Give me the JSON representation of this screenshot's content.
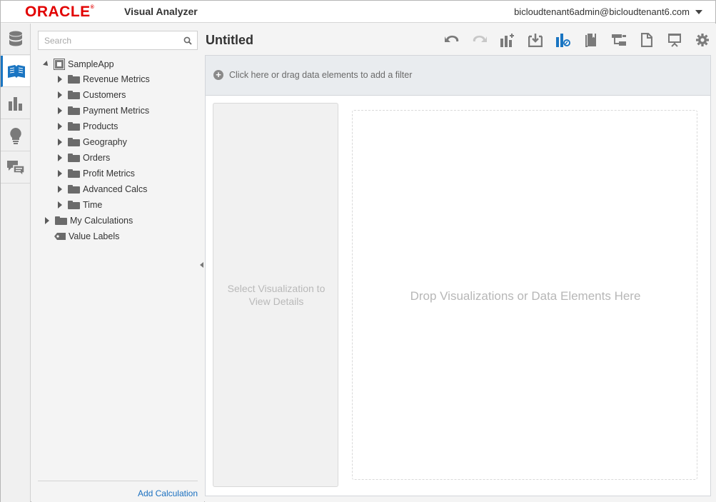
{
  "header": {
    "brand": "ORACLE",
    "brand_mark": "®",
    "app_title": "Visual Analyzer",
    "user": "bicloudtenant6admin@bicloudtenant6.com"
  },
  "rail": {
    "items": [
      {
        "icon": "database-icon",
        "active": false
      },
      {
        "icon": "open-book-icon",
        "active": true
      },
      {
        "icon": "bar-chart-icon",
        "active": false
      },
      {
        "icon": "lightbulb-icon",
        "active": false
      },
      {
        "icon": "chat-bubbles-icon",
        "active": false
      }
    ]
  },
  "data_panel": {
    "search_placeholder": "Search",
    "root": "SampleApp",
    "children": [
      "Revenue Metrics",
      "Customers",
      "Payment Metrics",
      "Products",
      "Geography",
      "Orders",
      "Profit Metrics",
      "Advanced Calcs",
      "Time"
    ],
    "my_calculations": "My Calculations",
    "value_labels": "Value Labels",
    "add_calculation": "Add Calculation"
  },
  "main": {
    "title": "Untitled",
    "toolbar": [
      "undo-icon",
      "redo-icon",
      "add-visualization-icon",
      "add-data-icon",
      "explore-icon",
      "bookmark-icon",
      "hierarchy-icon",
      "export-icon",
      "presentation-icon",
      "settings-icon"
    ],
    "filter_hint": "Click here or drag data elements to add a filter",
    "details_hint": "Select Visualization to View Details",
    "drop_hint": "Drop Visualizations or Data Elements Here"
  },
  "colors": {
    "brand_red": "#e20000",
    "accent_blue": "#1a75c2",
    "link_blue": "#1a70c0"
  }
}
